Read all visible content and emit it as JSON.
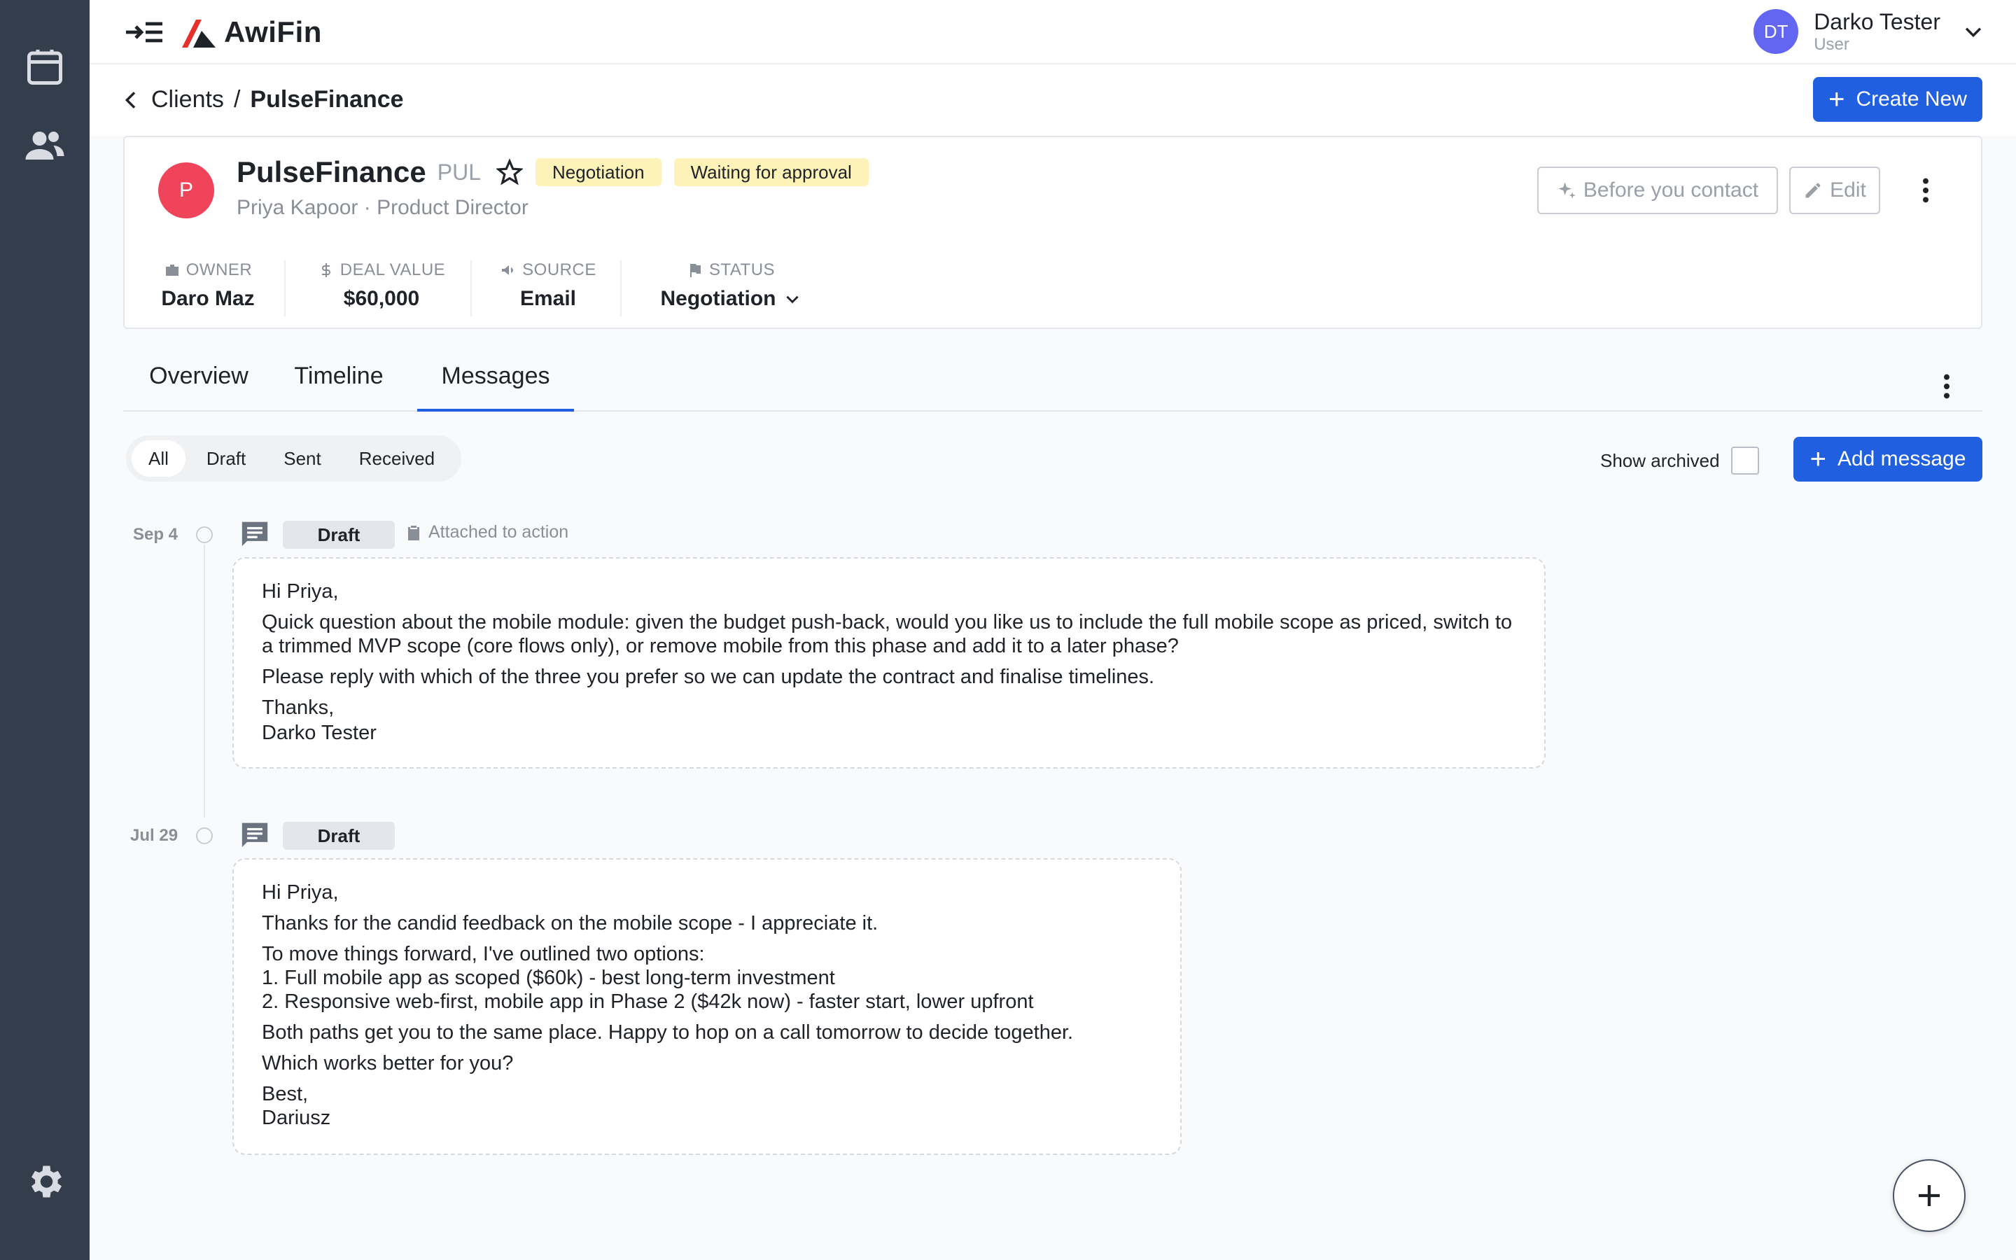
{
  "app": {
    "name": "AwiFin"
  },
  "user": {
    "initials": "DT",
    "name": "Darko Tester",
    "role": "User"
  },
  "breadcrumb": {
    "parent": "Clients",
    "separator": "/",
    "current": "PulseFinance"
  },
  "actions": {
    "create_new": "Create New"
  },
  "client": {
    "initial": "P",
    "name": "PulseFinance",
    "code": "PUL",
    "badges": [
      "Negotiation",
      "Waiting for approval"
    ],
    "contact": "Priya Kapoor · Product Director",
    "before_contact_label": "Before you contact",
    "edit_label": "Edit",
    "meta": {
      "owner_label": "OWNER",
      "owner": "Daro Maz",
      "deal_label": "DEAL VALUE",
      "deal": "$60,000",
      "source_label": "SOURCE",
      "source": "Email",
      "status_label": "STATUS",
      "status": "Negotiation"
    }
  },
  "tabs": [
    "Overview",
    "Timeline",
    "Messages"
  ],
  "active_tab": "Messages",
  "filters": [
    "All",
    "Draft",
    "Sent",
    "Received"
  ],
  "active_filter": "All",
  "show_archived_label": "Show archived",
  "show_archived_checked": false,
  "add_message_label": "Add message",
  "messages": [
    {
      "date": "Sep 4",
      "status": "Draft",
      "attached": "Attached to action",
      "paragraphs": [
        "Hi Priya,",
        "Quick question about the mobile module: given the budget push-back, would you like us to include the full mobile scope as priced, switch to a trimmed MVP scope (core flows only), or remove mobile from this phase and add it to a later phase?",
        "Please reply with which of the three you prefer so we can update the contract and finalise timelines.",
        "Thanks,",
        "Darko Tester"
      ]
    },
    {
      "date": "Jul 29",
      "status": "Draft",
      "paragraphs": [
        "Hi Priya,",
        "Thanks for the candid feedback on the mobile scope - I appreciate it.",
        "To move things forward, I've outlined two options:",
        "1. Full mobile app as scoped ($60k) - best long-term investment",
        "2. Responsive web-first, mobile app in Phase 2 ($42k now) - faster start, lower upfront",
        "Both paths get you to the same place. Happy to hop on a call tomorrow to decide together.",
        "Which works better for you?",
        "Best,",
        "Dariusz"
      ]
    }
  ],
  "colors": {
    "primary": "#1f5fe0",
    "rail": "#343d4b",
    "badge": "#fdf2b8",
    "avatar_client": "#ef4459",
    "avatar_user": "#6366f1"
  }
}
